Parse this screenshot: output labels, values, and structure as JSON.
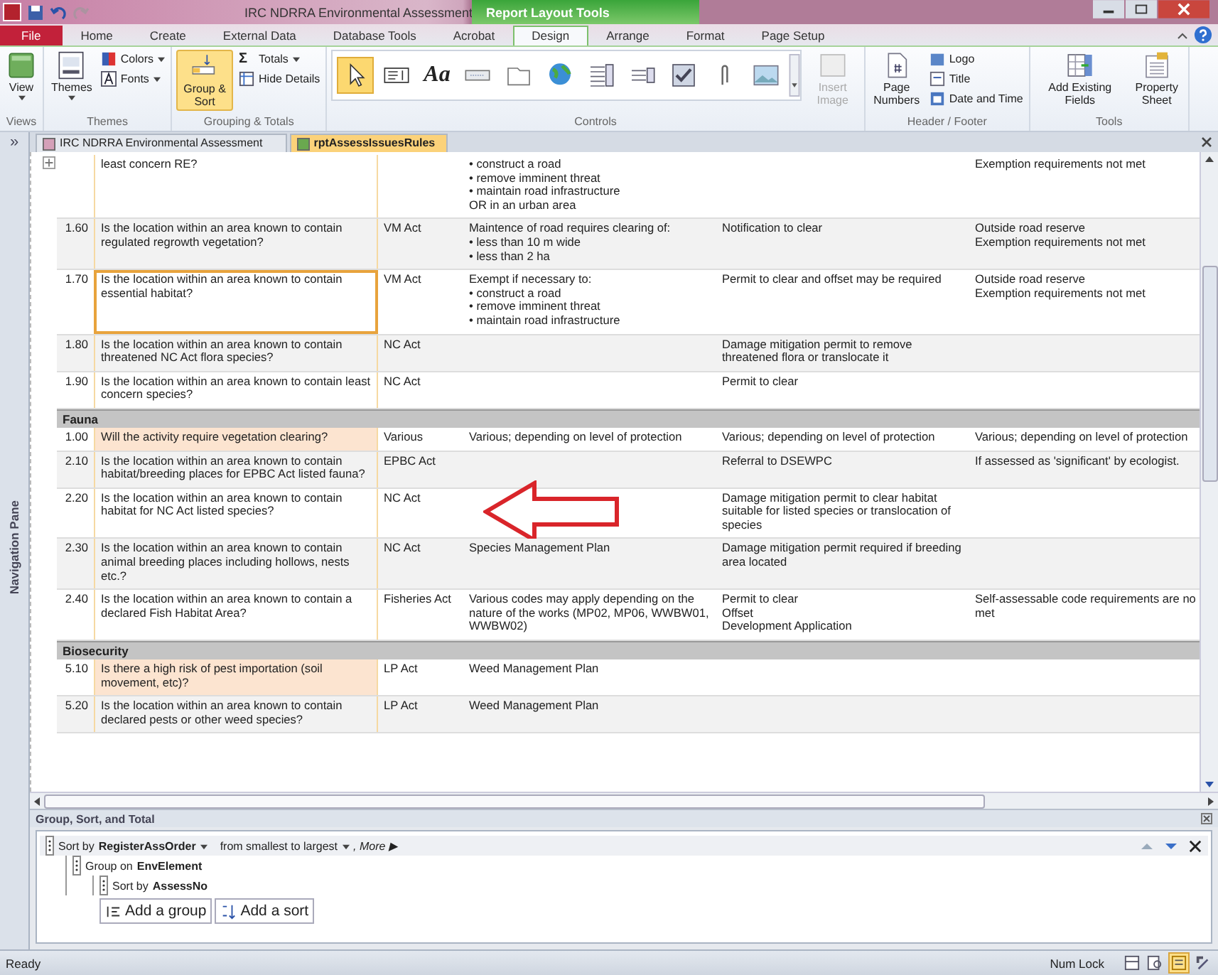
{
  "window": {
    "title": "IRC NDRRA Environmental Assessment",
    "context_label": "Report Layout Tools"
  },
  "ribbon_tabs": [
    {
      "label": "File",
      "kind": "file",
      "selected": false
    },
    {
      "label": "Home",
      "kind": "tab",
      "selected": false
    },
    {
      "label": "Create",
      "kind": "tab",
      "selected": false
    },
    {
      "label": "External Data",
      "kind": "tab",
      "selected": false
    },
    {
      "label": "Database Tools",
      "kind": "tab",
      "selected": false
    },
    {
      "label": "Acrobat",
      "kind": "tab",
      "selected": false
    },
    {
      "label": "Design",
      "kind": "tab",
      "selected": true
    },
    {
      "label": "Arrange",
      "kind": "tab",
      "selected": false
    },
    {
      "label": "Format",
      "kind": "tab",
      "selected": false
    },
    {
      "label": "Page Setup",
      "kind": "tab",
      "selected": false
    }
  ],
  "ribbon": {
    "views": {
      "label": "Views",
      "view": "View"
    },
    "themes": {
      "label": "Themes",
      "themes": "Themes",
      "colors": "Colors",
      "fonts": "Fonts"
    },
    "grouping": {
      "label": "Grouping & Totals",
      "group_sort": {
        "label": "Group & Sort",
        "selected": true
      },
      "totals_glyph": "Σ",
      "totals": "Totals",
      "hide_details": "Hide Details"
    },
    "controls": {
      "label": "Controls",
      "select_tool": {
        "selected": true
      },
      "label_tool_glyph": "Aa",
      "insert_image": {
        "label": "Insert Image",
        "disabled": true
      }
    },
    "header_footer": {
      "label": "Header / Footer",
      "page_numbers": "Page Numbers",
      "logo": "Logo",
      "title": "Title",
      "date_time": "Date and Time"
    },
    "tools": {
      "label": "Tools",
      "add_fields": "Add Existing Fields",
      "property_sheet": "Property Sheet"
    }
  },
  "nav_pane": {
    "toggle": "»",
    "label": "Navigation Pane"
  },
  "doc_tabs": [
    {
      "label": "IRC NDRRA Environmental Assessment",
      "selected": false
    },
    {
      "label": "rptAssessIssuesRules",
      "selected": true
    }
  ],
  "report": {
    "sections": [
      {
        "kind": "row",
        "question": "least concern RE?",
        "measures": [
          "• construct a road",
          "• remove imminent threat",
          "• maintain road infrastructure",
          "OR in an urban area"
        ],
        "notes": [
          "Exemption requirements not met"
        ],
        "highlighted": false,
        "selected": false
      },
      {
        "kind": "row",
        "number": "1.60",
        "question": "Is the location within an area known to contain regulated regrowth vegetation?",
        "act": "VM Act",
        "measures": [
          "Maintence of road requires clearing of:",
          "• less than 10 m wide",
          "• less than 2 ha"
        ],
        "approval": [
          "Notification to clear"
        ],
        "notes": [
          "Outside road reserve",
          "Exemption requirements not met"
        ],
        "highlighted": false,
        "selected": false
      },
      {
        "kind": "row",
        "number": "1.70",
        "question": "Is the location within an area known to contain essential habitat?",
        "act": "VM Act",
        "measures": [
          "Exempt if necessary to:",
          "• construct a road",
          "• remove imminent threat",
          "• maintain road infrastructure"
        ],
        "approval": [
          "Permit to clear and offset may be required"
        ],
        "notes": [
          "Outside road reserve",
          "Exemption requirements not met"
        ],
        "highlighted": false,
        "selected": true
      },
      {
        "kind": "row",
        "number": "1.80",
        "question": "Is the location within an area known to contain threatened NC Act flora species?",
        "act": "NC Act",
        "approval": [
          "Damage mitigation permit to remove threatened flora or translocate it"
        ],
        "highlighted": false,
        "selected": false
      },
      {
        "kind": "row",
        "number": "1.90",
        "question": "Is the location within an area known to contain least concern species?",
        "act": "NC Act",
        "approval": [
          "Permit to clear"
        ],
        "highlighted": false,
        "selected": false
      },
      {
        "kind": "group",
        "label": "Fauna"
      },
      {
        "kind": "row",
        "number": "1.00",
        "question": "Will the activity require vegetation clearing?",
        "act": "Various",
        "measures": [
          "Various; depending on level of protection"
        ],
        "approval": [
          "Various; depending on level of protection"
        ],
        "notes": [
          "Various; depending on level of protection"
        ],
        "highlighted": true,
        "selected": false
      },
      {
        "kind": "row",
        "number": "2.10",
        "question": "Is the location within an area known to contain habitat/breeding places for EPBC Act listed fauna?",
        "act": "EPBC Act",
        "approval": [
          "Referral to DSEWPC"
        ],
        "notes": [
          "If assessed as 'significant' by ecologist."
        ],
        "highlighted": false,
        "selected": false
      },
      {
        "kind": "row",
        "number": "2.20",
        "question": "Is the location within an area known to contain habitat for NC Act listed species?",
        "act": "NC Act",
        "approval": [
          "Damage mitigation permit to clear habitat suitable for listed species or translocation of species"
        ],
        "highlighted": false,
        "selected": false,
        "annotated": true
      },
      {
        "kind": "row",
        "number": "2.30",
        "question": "Is the location within an area known to contain animal breeding places including hollows, nests etc.?",
        "act": "NC Act",
        "measures": [
          "Species Management Plan"
        ],
        "approval": [
          "Damage mitigation permit required if breeding area located"
        ],
        "highlighted": false,
        "selected": false
      },
      {
        "kind": "row",
        "number": "2.40",
        "question": "Is the location within an area known to contain a declared Fish Habitat Area?",
        "act": "Fisheries Act",
        "measures": [
          "Various codes may apply depending on the nature of the works (MP02, MP06, WWBW01, WWBW02)"
        ],
        "approval": [
          "Permit to clear",
          "Offset",
          "Development Application"
        ],
        "notes": [
          "Self-assessable code requirements are no",
          "met"
        ],
        "highlighted": false,
        "selected": false
      },
      {
        "kind": "group",
        "label": "Biosecurity"
      },
      {
        "kind": "row",
        "number": "5.10",
        "question": "Is there a high risk of pest importation (soil movement, etc)?",
        "act": "LP Act",
        "measures": [
          "Weed Management Plan"
        ],
        "highlighted": true,
        "selected": false
      },
      {
        "kind": "row",
        "number": "5.20",
        "question": "Is the location within an area known to contain declared pests or other weed species?",
        "act": "LP Act",
        "measures": [
          "Weed Management Plan"
        ],
        "highlighted": false,
        "selected": false
      }
    ]
  },
  "group_sort_pane": {
    "title": "Group, Sort, and Total",
    "levels": [
      {
        "prefix": "Sort by",
        "field": "RegisterAssOrder",
        "order": "from smallest to largest",
        "more": ", More ▶",
        "children": [
          {
            "prefix": "Group on",
            "field": "EnvElement",
            "children": [
              {
                "prefix": "Sort by",
                "field": "AssessNo"
              }
            ]
          }
        ]
      }
    ],
    "add_group": "Add a group",
    "add_sort": "Add a sort"
  },
  "status_bar": {
    "text": "Ready",
    "num_lock": "Num Lock"
  }
}
